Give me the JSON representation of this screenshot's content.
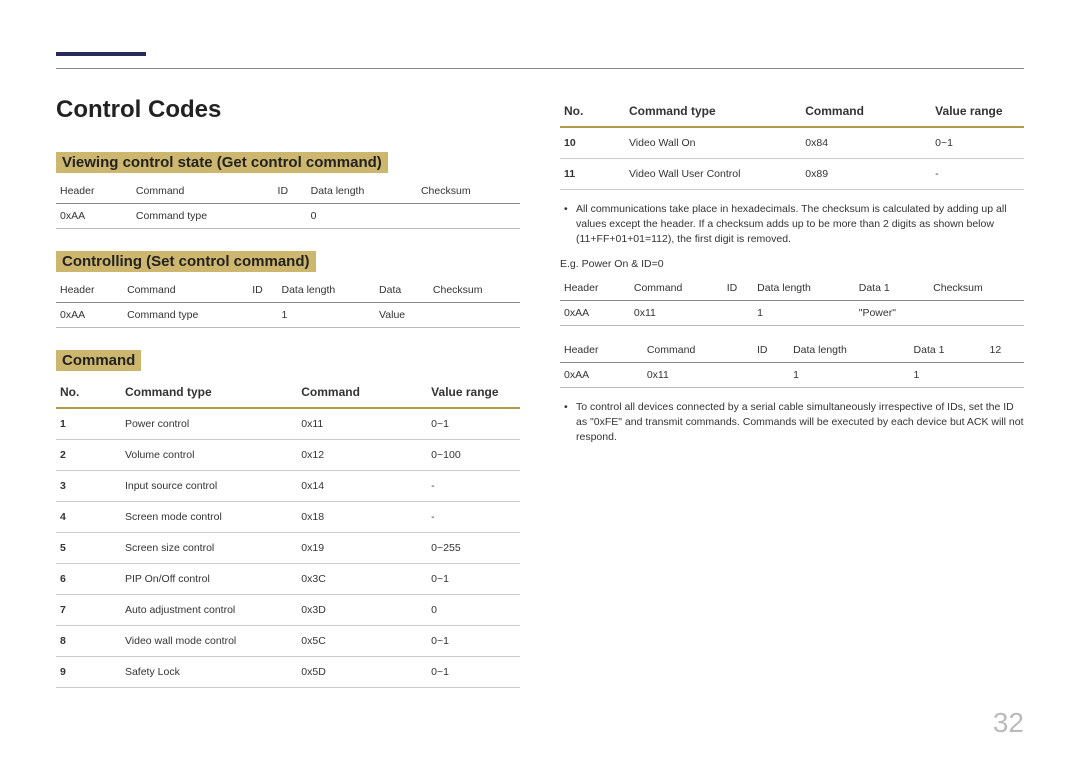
{
  "title": "Control Codes",
  "section_get": "Viewing control state (Get control command)",
  "section_set": "Controlling (Set control command)",
  "section_cmd": "Command",
  "get_table": {
    "headers": [
      "Header",
      "Command",
      "ID",
      "Data length",
      "Checksum"
    ],
    "row": [
      "0xAA",
      "Command type",
      "",
      "0",
      ""
    ]
  },
  "set_table": {
    "headers": [
      "Header",
      "Command",
      "ID",
      "Data length",
      "Data",
      "Checksum"
    ],
    "row": [
      "0xAA",
      "Command type",
      "",
      "1",
      "Value",
      ""
    ]
  },
  "cmd_headers": {
    "no": "No.",
    "type": "Command type",
    "cmd": "Command",
    "range": "Value range"
  },
  "commands_left": [
    {
      "no": "1",
      "type": "Power control",
      "cmd": "0x11",
      "range": "0~1"
    },
    {
      "no": "2",
      "type": "Volume control",
      "cmd": "0x12",
      "range": "0~100"
    },
    {
      "no": "3",
      "type": "Input source control",
      "cmd": "0x14",
      "range": "-"
    },
    {
      "no": "4",
      "type": "Screen mode control",
      "cmd": "0x18",
      "range": "-"
    },
    {
      "no": "5",
      "type": "Screen size control",
      "cmd": "0x19",
      "range": "0~255"
    },
    {
      "no": "6",
      "type": "PIP On/Off control",
      "cmd": "0x3C",
      "range": "0~1"
    },
    {
      "no": "7",
      "type": "Auto adjustment control",
      "cmd": "0x3D",
      "range": "0"
    },
    {
      "no": "8",
      "type": "Video wall mode control",
      "cmd": "0x5C",
      "range": "0~1"
    },
    {
      "no": "9",
      "type": "Safety Lock",
      "cmd": "0x5D",
      "range": "0~1"
    }
  ],
  "commands_right": [
    {
      "no": "10",
      "type": "Video Wall On",
      "cmd": "0x84",
      "range": "0~1"
    },
    {
      "no": "11",
      "type": "Video Wall User Control",
      "cmd": "0x89",
      "range": "-"
    }
  ],
  "note1": "All communications take place in hexadecimals. The checksum is calculated by adding up all values except the header. If a checksum adds up to be more than 2 digits as shown below (11+FF+01+01=112), the first digit is removed.",
  "example_label": "E.g. Power On & ID=0",
  "ex1": {
    "headers": [
      "Header",
      "Command",
      "ID",
      "Data length",
      "Data 1",
      "Checksum"
    ],
    "row": [
      "0xAA",
      "0x11",
      "",
      "1",
      "\"Power\"",
      ""
    ]
  },
  "ex2": {
    "headers": [
      "Header",
      "Command",
      "ID",
      "Data length",
      "Data 1",
      "12"
    ],
    "row": [
      "0xAA",
      "0x11",
      "",
      "1",
      "1",
      ""
    ]
  },
  "note2": "To control all devices connected by a serial cable simultaneously irrespective of IDs, set the ID as \"0xFE\" and transmit commands. Commands will be executed by each device but ACK will not respond.",
  "page_number": "32"
}
